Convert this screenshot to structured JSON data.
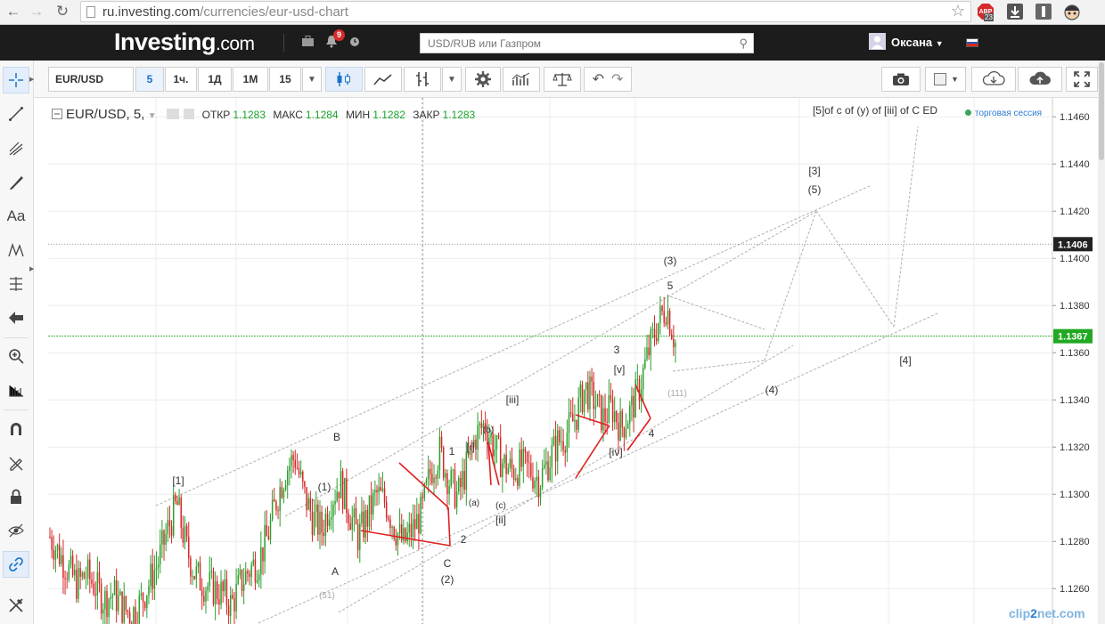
{
  "browser": {
    "url_host": "ru.investing.com",
    "url_path": "/currencies/eur-usd-chart",
    "adblock_badge": "23"
  },
  "header": {
    "logo_main": "Investing",
    "logo_suffix": ".com",
    "notification_count": "9",
    "search_placeholder": "USD/RUB или Газпром",
    "user_name": "Оксана"
  },
  "toolbar": {
    "symbol": "EUR/USD",
    "intervals": [
      "5",
      "1ч.",
      "1Д",
      "1М",
      "15"
    ],
    "selected_interval": "5"
  },
  "legend": {
    "symbol": "EUR/USD, 5,",
    "open_label": "ОТКР",
    "open": "1.1283",
    "high_label": "МАКС",
    "high": "1.1284",
    "low_label": "МИН",
    "low": "1.1282",
    "close_label": "ЗАКР",
    "close": "1.1283",
    "session": "торговая сессия"
  },
  "chart_data": {
    "type": "candlestick",
    "series": [
      {
        "name": "",
        "values": [
          1.1282,
          1.1275,
          1.1268,
          1.1262,
          1.1266,
          1.1261,
          1.1255,
          1.1258,
          1.1252,
          1.1249,
          1.1254,
          1.1263,
          1.1272,
          1.1285,
          1.1296,
          1.1278,
          1.1266,
          1.1262,
          1.126,
          1.1258,
          1.1253,
          1.1262,
          1.1268,
          1.1272,
          1.1282,
          1.1298,
          1.131,
          1.1316,
          1.13,
          1.129,
          1.1285,
          1.1298,
          1.1305,
          1.1293,
          1.1282,
          1.129,
          1.13,
          1.1297,
          1.1286,
          1.1279,
          1.1285,
          1.1292,
          1.131,
          1.1318,
          1.1306,
          1.1299,
          1.1312,
          1.1325,
          1.133,
          1.132,
          1.1313,
          1.131,
          1.1312,
          1.131,
          1.1306,
          1.1314,
          1.1322,
          1.1326,
          1.1333,
          1.1345,
          1.134,
          1.1332,
          1.1337,
          1.1328,
          1.1335,
          1.1345,
          1.136,
          1.1372,
          1.138,
          1.1364
        ]
      }
    ],
    "ylim": [
      1.1245,
      1.1468
    ],
    "y_ticks": [
      "1.1460",
      "1.1440",
      "1.1420",
      "1.1400",
      "1.1380",
      "1.1360",
      "1.1340",
      "1.1320",
      "1.1300",
      "1.1280",
      "1.1260"
    ],
    "price_markers": [
      {
        "label": "1.1406",
        "value": 1.1406,
        "color": "#222222"
      },
      {
        "label": "1.1367",
        "value": 1.1367,
        "color": "#22a822"
      }
    ],
    "colors": {
      "up": "#2ca02c",
      "down": "#d62728",
      "pattern": "#e02020",
      "guides": "#b0b0b0"
    },
    "wave_labels": [
      {
        "text": "[1]",
        "x": 200,
        "y": 540
      },
      {
        "text": "B",
        "x": 378,
        "y": 491
      },
      {
        "text": "(1)",
        "x": 364,
        "y": 547
      },
      {
        "text": "A",
        "x": 376,
        "y": 642
      },
      {
        "text": "(51)",
        "x": 367,
        "y": 668
      },
      {
        "text": "1",
        "x": 507,
        "y": 507
      },
      {
        "text": "2",
        "x": 520,
        "y": 606
      },
      {
        "text": "C",
        "x": 502,
        "y": 633
      },
      {
        "text": "(2)",
        "x": 502,
        "y": 651
      },
      {
        "text": "[i]",
        "x": 528,
        "y": 502
      },
      {
        "text": "(a)",
        "x": 532,
        "y": 564
      },
      {
        "text": "(b)",
        "x": 548,
        "y": 482
      },
      {
        "text": "(c)",
        "x": 562,
        "y": 567
      },
      {
        "text": "[ii]",
        "x": 562,
        "y": 584
      },
      {
        "text": "[iii]",
        "x": 575,
        "y": 449
      },
      {
        "text": "[iv]",
        "x": 691,
        "y": 508
      },
      {
        "text": "3",
        "x": 692,
        "y": 393
      },
      {
        "text": "[v]",
        "x": 695,
        "y": 415
      },
      {
        "text": "4",
        "x": 731,
        "y": 487
      },
      {
        "text": "(111)",
        "x": 760,
        "y": 441
      },
      {
        "text": "5",
        "x": 752,
        "y": 321
      },
      {
        "text": "(3)",
        "x": 752,
        "y": 293
      },
      {
        "text": "(4)",
        "x": 866,
        "y": 438
      },
      {
        "text": "[3]",
        "x": 914,
        "y": 192
      },
      {
        "text": "(5)",
        "x": 914,
        "y": 213
      },
      {
        "text": "[4]",
        "x": 1016,
        "y": 405
      },
      {
        "text": "[5]of c of (y) of [iii] of C ED",
        "x": 982,
        "y": 124
      }
    ]
  },
  "watermark": {
    "a": "clip",
    "b": "2",
    "c": "net.com"
  }
}
